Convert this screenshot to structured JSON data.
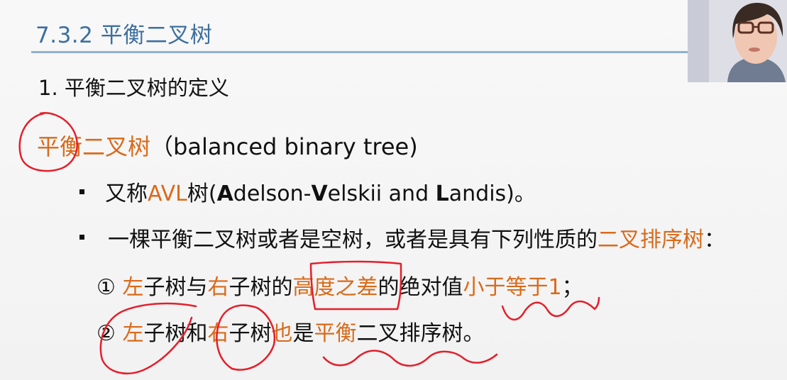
{
  "slide": {
    "title": "7.3.2 平衡二叉树",
    "heading": "1. 平衡二叉树的定义",
    "term": {
      "zh": "平衡二叉树",
      "en": "（balanced binary tree)"
    },
    "bullet1": {
      "p1": "又称",
      "avl": "AVL",
      "p2": "树(",
      "a": "A",
      "p3": "delson-",
      "v": "V",
      "p4": "elskii and ",
      "l": "L",
      "p5": "andis)。"
    },
    "bullet2": {
      "p1": "一棵平衡二叉树或者是空树，或者是具有下列性质的",
      "hl": "二叉排序树",
      "p2": "："
    },
    "cond1": {
      "num": "①",
      "left": "左",
      "p1": "子树与",
      "right": "右",
      "p2": "子树的",
      "diff": "高度之差",
      "p3": "的绝对值",
      "le": "小于等于1",
      "p4": "；"
    },
    "cond2": {
      "num": "②",
      "left": "左",
      "p1": "子树和",
      "right": "右",
      "p2": "子树",
      "also": "也",
      "p3": "是",
      "bal": "平衡",
      "p4": "二叉排序树。"
    }
  },
  "colors": {
    "title": "#3d6fa0",
    "rule": "#8fb1d3",
    "highlight": "#d96a1a",
    "annotation": "#e41f2b",
    "text": "#111111"
  },
  "icons": {
    "bullet": "square-bullet",
    "webcam": "presenter-video"
  }
}
